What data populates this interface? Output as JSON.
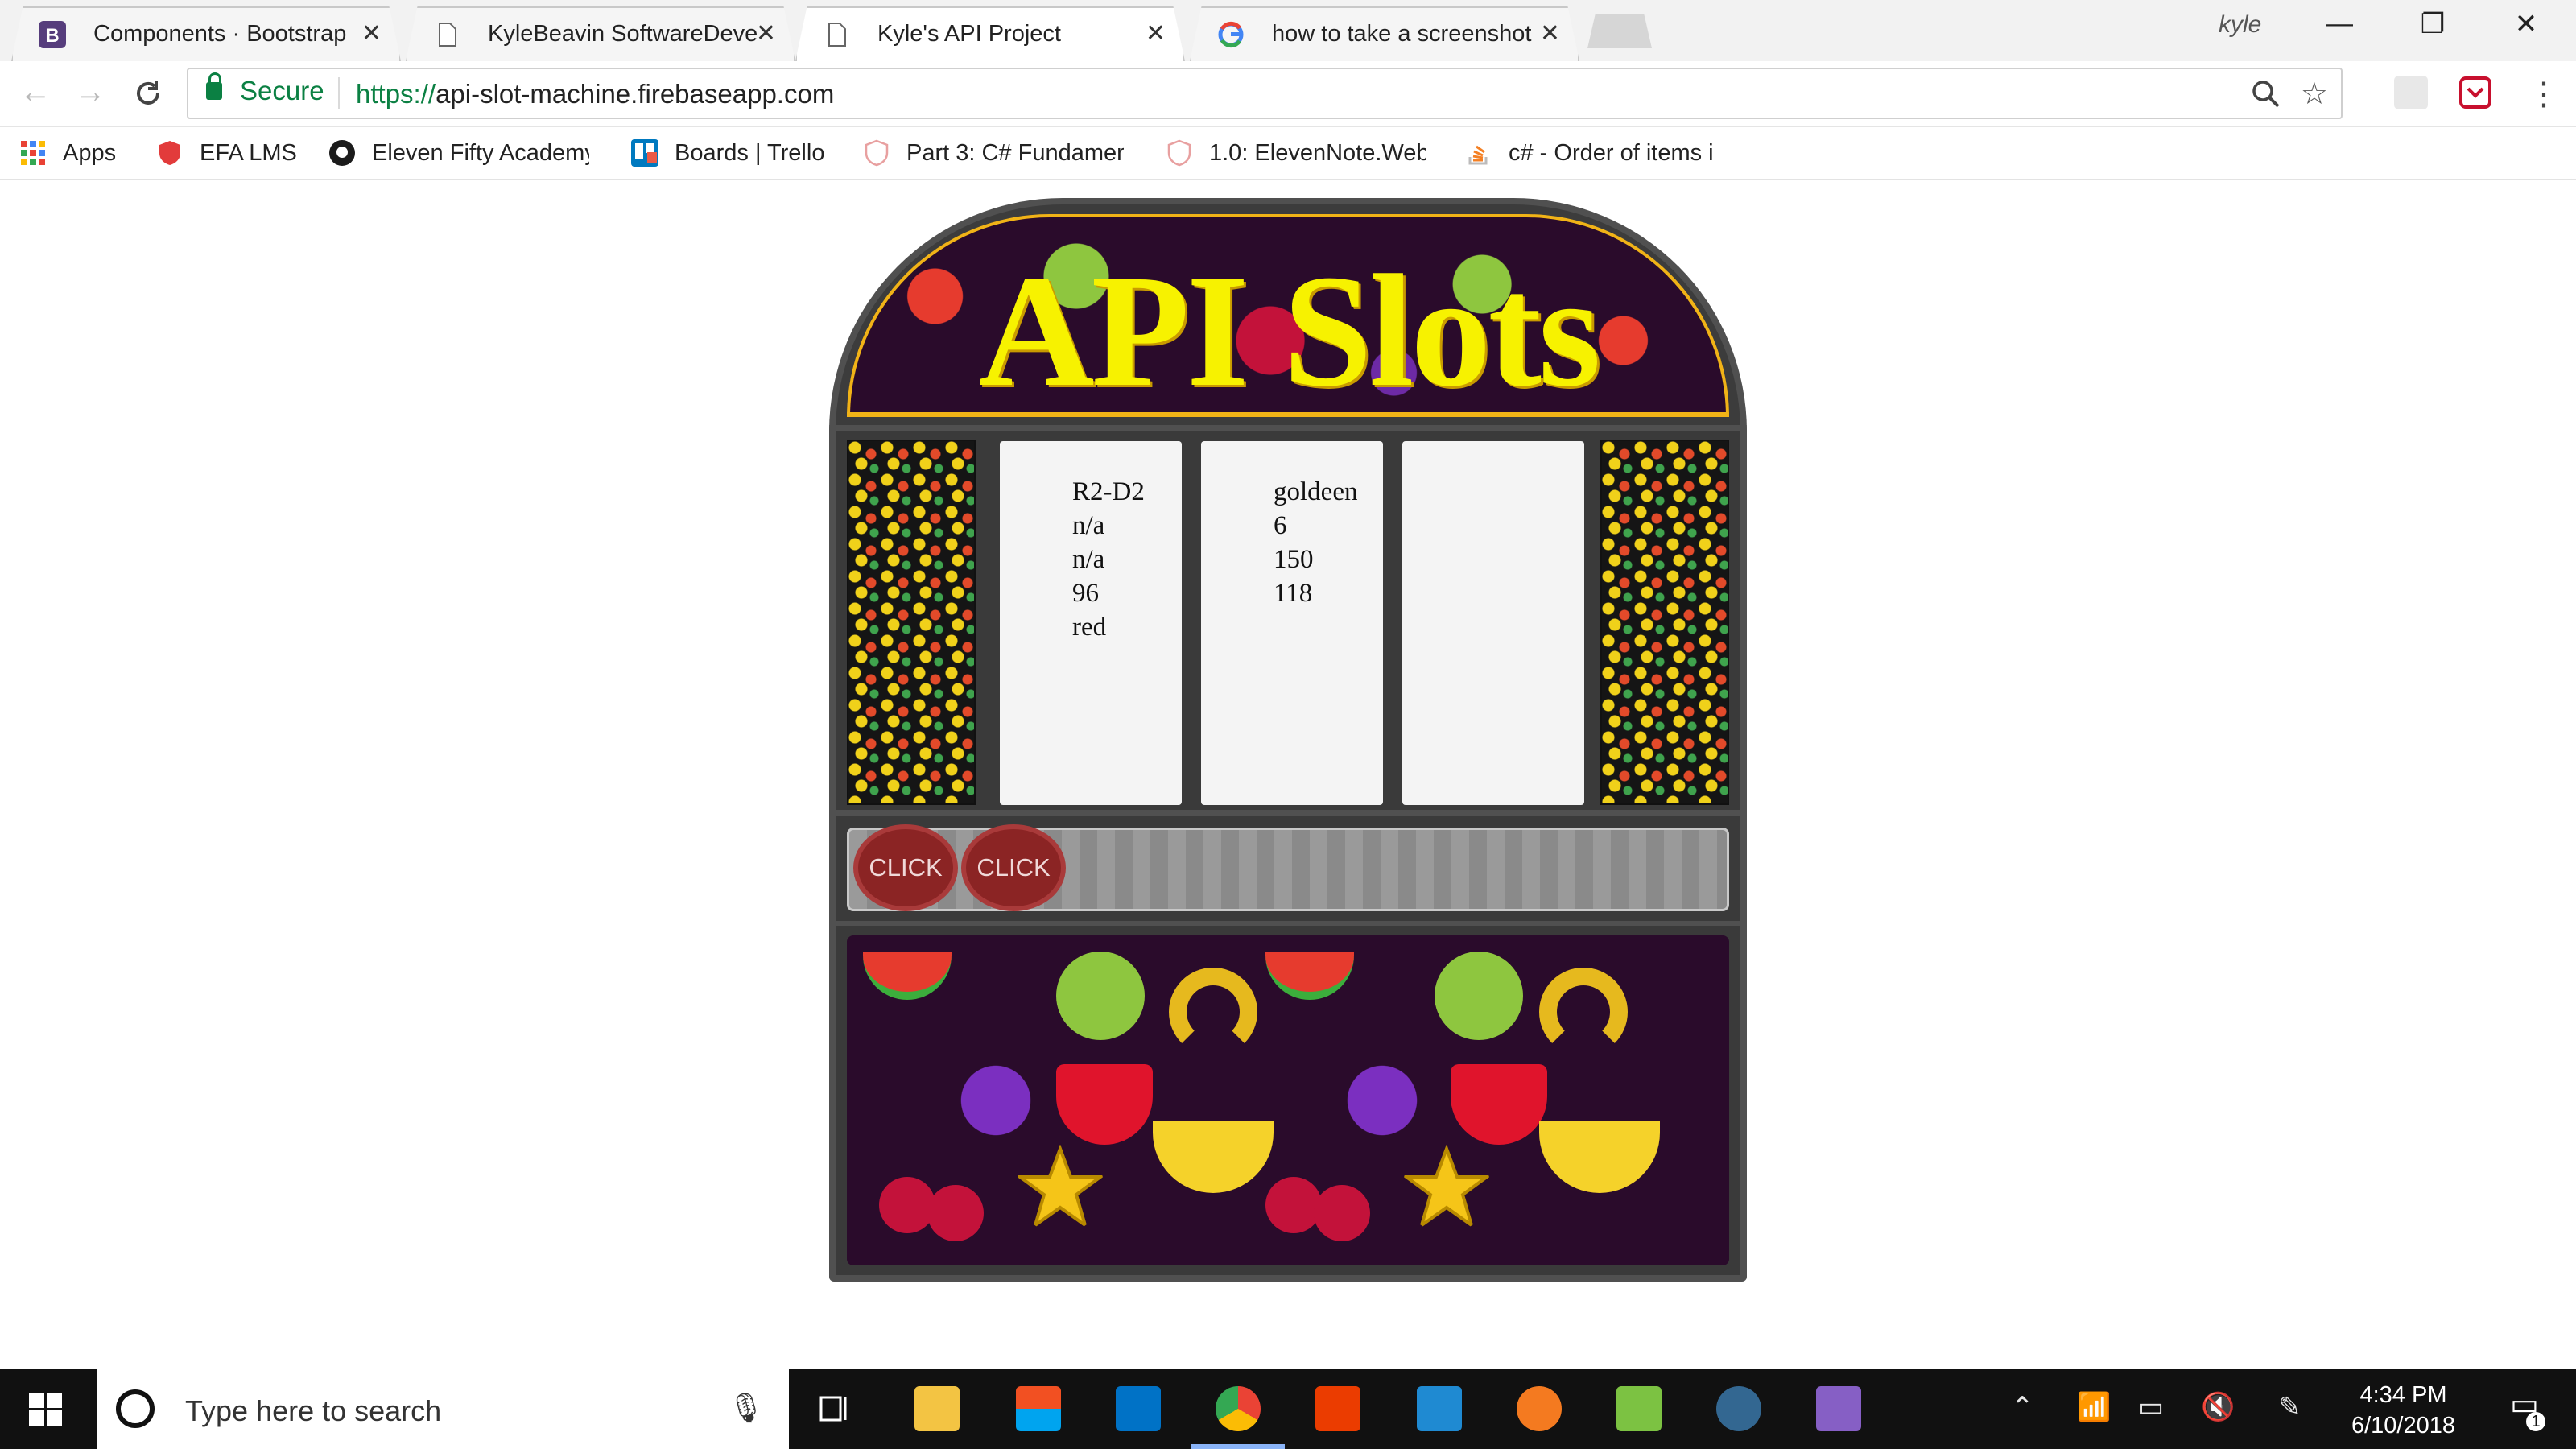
{
  "browser": {
    "tabs": [
      {
        "title": "Components · Bootstrap",
        "favicon": "bootstrap-b-icon",
        "active": false
      },
      {
        "title": "KyleBeavin SoftwareDeve",
        "favicon": "document-icon",
        "active": false
      },
      {
        "title": "Kyle's API Project",
        "favicon": "document-icon",
        "active": true
      },
      {
        "title": "how to take a screenshot",
        "favicon": "google-g-icon",
        "active": false
      }
    ],
    "profile_name": "kyle",
    "address_bar": {
      "secure_label": "Secure",
      "url_scheme": "https://",
      "url_host": "api-slot-machine.firebaseapp.com"
    },
    "bookmarks": [
      {
        "label": "Apps",
        "icon": "apps-grid-icon"
      },
      {
        "label": "EFA LMS",
        "icon": "shield-icon"
      },
      {
        "label": "Eleven Fifty Academy",
        "icon": "github-icon"
      },
      {
        "label": "Boards | Trello",
        "icon": "trello-icon"
      },
      {
        "label": "Part 3: C# Fundamen",
        "icon": "shield-outline-icon"
      },
      {
        "label": "1.0: ElevenNote.Web",
        "icon": "shield-outline-icon"
      },
      {
        "label": "c# - Order of items i",
        "icon": "stackoverflow-icon"
      }
    ]
  },
  "slot_machine": {
    "title": "API Slots",
    "reels": [
      {
        "lines": [
          "R2-D2",
          "n/a",
          "n/a",
          "96",
          "red"
        ]
      },
      {
        "lines": [
          "goldeen",
          "6",
          "150",
          "118"
        ]
      },
      {
        "lines": []
      }
    ],
    "buttons": [
      {
        "label": "CLICK"
      },
      {
        "label": "CLICK"
      }
    ]
  },
  "taskbar": {
    "search_placeholder": "Type here to search",
    "time": "4:34 PM",
    "date": "6/10/2018",
    "notification_count": "1"
  },
  "colors": {
    "secure_green": "#0b8043",
    "title_yellow": "#f7f200",
    "button_red": "#8b2424",
    "machine_frame": "#3a3a3a"
  }
}
